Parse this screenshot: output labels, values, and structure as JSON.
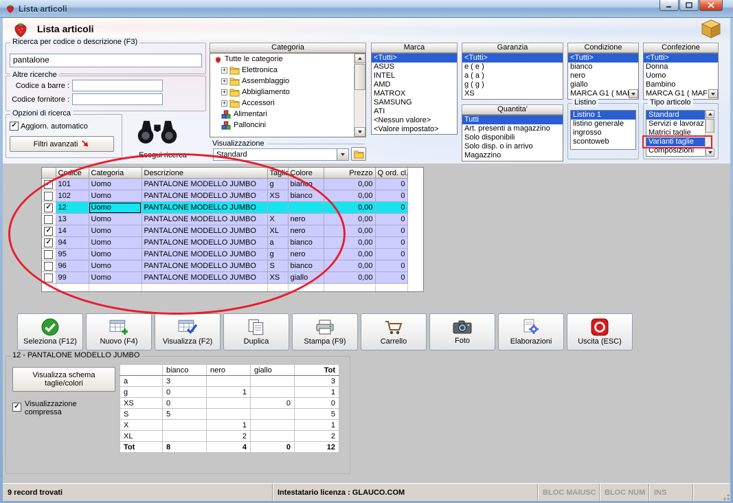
{
  "window": {
    "title": "Lista articoli"
  },
  "header": {
    "title": "Lista articoli"
  },
  "search": {
    "group_label": "Ricerca per codice o descrizione (F3)",
    "query_value": "pantalone",
    "altre_label": "Altre ricerche",
    "barcode_label": "Codice a barre :",
    "supplier_label": "Codice fornitore :",
    "options_label": "Opzioni di ricerca",
    "auto_update_label": "Aggiorn. automatico",
    "auto_update_check": "✓",
    "filters_button_label": "Filtri avanzati",
    "execute_label": "Esegui ricerca"
  },
  "categoria": {
    "header": "Categoria",
    "tree": [
      "Tutte le categorie",
      "Elettronica",
      "Assemblaggio",
      "Abbigliamento",
      "Accessori",
      "Alimentari",
      "Palloncini"
    ],
    "visualizzazione_label": "Visualizzazione",
    "visualizzazione_value": "Standard"
  },
  "marca": {
    "header": "Marca",
    "items": [
      "<Tutti>",
      "ASUS",
      "INTEL",
      "AMD",
      "MATROX",
      "SAMSUNG",
      "ATI",
      "<Nessun valore>",
      "<Valore impostato>"
    ],
    "selected": "<Tutti>"
  },
  "garanzia": {
    "header": "Garanzia",
    "items": [
      "<Tutti>",
      "e ( e )",
      "a ( a )",
      "g ( g )",
      "XS"
    ],
    "selected": "<Tutti>"
  },
  "condizione": {
    "header": "Condizione",
    "items": [
      "<Tutti>",
      "bianco",
      "nero",
      "giallo",
      "MARCA G1 ( MAF"
    ],
    "selected": "<Tutti>"
  },
  "confezione": {
    "header": "Confezione",
    "items": [
      "<Tutti>",
      "Donna",
      "Uomo",
      "Bambino",
      "MARCA G1 ( MAF"
    ],
    "selected": "<Tutti>"
  },
  "quantita": {
    "header": "Quantita'",
    "items": [
      "Tutti",
      "Art. presenti a magazzino",
      "Solo disponibili",
      "Solo disp. o in arrivo",
      "Magazzino"
    ],
    "selected": "Tutti"
  },
  "listino": {
    "header": "Listino",
    "items": [
      "Listino 1",
      "listino generale",
      "ingrosso",
      "scontoweb"
    ],
    "selected": "Listino 1"
  },
  "tipo_articolo": {
    "header": "Tipo articolo",
    "items": [
      "Standard",
      "Servizi e lavoraz",
      "Matrici taglie",
      "Varianti taglie",
      "Composizioni"
    ],
    "selected": "Varianti taglie",
    "highlighted": [
      "Standard",
      "Varianti taglie"
    ]
  },
  "table": {
    "columns": {
      "codice": "Codice",
      "categoria": "Categoria",
      "descrizione": "Descrizione",
      "taglia": "Taglia",
      "colore": "Colore",
      "prezzo": "Prezzo",
      "q_ord": "Q ord. cl."
    },
    "rows": [
      {
        "check": "✓",
        "codice": "101",
        "categoria": "Uomo",
        "descrizione": "PANTALONE MODELLO JUMBO",
        "taglia": "g",
        "colore": "bianco",
        "prezzo": "0,00",
        "q_ord": "0"
      },
      {
        "check": "",
        "codice": "102",
        "categoria": "Uomo",
        "descrizione": "PANTALONE MODELLO JUMBO",
        "taglia": "XS",
        "colore": "bianco",
        "prezzo": "0,00",
        "q_ord": "0"
      },
      {
        "check": "✓",
        "codice": "12",
        "categoria": "Uomo",
        "descrizione": "PANTALONE MODELLO JUMBO",
        "taglia": "",
        "colore": "",
        "prezzo": "0,00",
        "q_ord": "0"
      },
      {
        "check": "",
        "codice": "13",
        "categoria": "Uomo",
        "descrizione": "PANTALONE MODELLO JUMBO",
        "taglia": "X",
        "colore": "nero",
        "prezzo": "0,00",
        "q_ord": "0"
      },
      {
        "check": "✓",
        "codice": "14",
        "categoria": "Uomo",
        "descrizione": "PANTALONE MODELLO JUMBO",
        "taglia": "XL",
        "colore": "nero",
        "prezzo": "0,00",
        "q_ord": "0"
      },
      {
        "check": "✓",
        "codice": "94",
        "categoria": "Uomo",
        "descrizione": "PANTALONE MODELLO JUMBO",
        "taglia": "a",
        "colore": "bianco",
        "prezzo": "0,00",
        "q_ord": "0"
      },
      {
        "check": "",
        "codice": "95",
        "categoria": "Uomo",
        "descrizione": "PANTALONE MODELLO JUMBO",
        "taglia": "g",
        "colore": "nero",
        "prezzo": "0,00",
        "q_ord": "0"
      },
      {
        "check": "",
        "codice": "96",
        "categoria": "Uomo",
        "descrizione": "PANTALONE MODELLO JUMBO",
        "taglia": "S",
        "colore": "bianco",
        "prezzo": "0,00",
        "q_ord": "0"
      },
      {
        "check": "",
        "codice": "99",
        "categoria": "Uomo",
        "descrizione": "PANTALONE MODELLO JUMBO",
        "taglia": "XS",
        "colore": "giallo",
        "prezzo": "0,00",
        "q_ord": "0"
      }
    ]
  },
  "toolbar": {
    "buttons": [
      "Seleziona (F12)",
      "Nuovo (F4)",
      "Visualizza (F2)",
      "Duplica",
      "Stampa (F9)",
      "Carrello",
      "Foto",
      "Elaborazioni",
      "Uscita (ESC)"
    ]
  },
  "detail": {
    "group_label": "12 - PANTALONE MODELLO JUMBO",
    "schema_button_label": "Visualizza schema taglie/colori",
    "compressed_label": "Visualizzazione compressa",
    "compressed_check": "✓",
    "matrix": {
      "headers": [
        "",
        "bianco",
        "nero",
        "giallo",
        "Tot"
      ],
      "rows": [
        [
          "a",
          "3",
          "",
          "",
          "3"
        ],
        [
          "g",
          "0",
          "1",
          "",
          "1"
        ],
        [
          "XS",
          "0",
          "",
          "0",
          "0"
        ],
        [
          "S",
          "5",
          "",
          "",
          "5"
        ],
        [
          "X",
          "",
          "1",
          "",
          "1"
        ],
        [
          "XL",
          "",
          "2",
          "",
          "2"
        ],
        [
          "Tot",
          "8",
          "4",
          "0",
          "12"
        ]
      ]
    }
  },
  "statusbar": {
    "records": "9 record trovati",
    "license": "Intestatario licenza : GLAUCO.COM",
    "keys": [
      "BLOC MAIUSC",
      "BLOC NUM",
      "INS"
    ]
  }
}
